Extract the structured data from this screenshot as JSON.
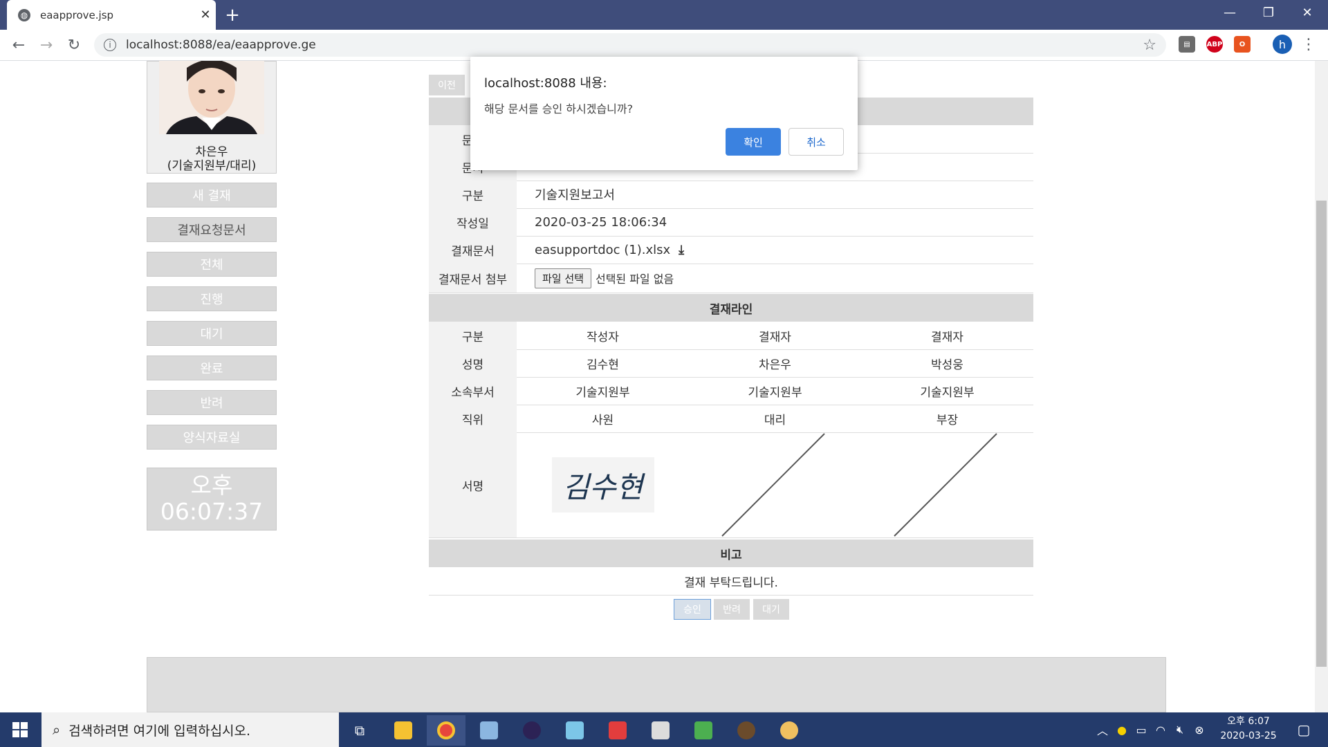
{
  "browser": {
    "tab_title": "eaapprove.jsp",
    "url": "localhost:8088/ea/eaapprove.ge"
  },
  "sidebar": {
    "user_name": "차은우",
    "user_dept": "(기술지원부/대리)",
    "menu": [
      "새 결재",
      "결재요청문서",
      "전체",
      "진행",
      "대기",
      "완료",
      "반려",
      "양식자료실"
    ],
    "clock_ampm": "오후",
    "clock_time": "06:07:37"
  },
  "document": {
    "prev_label": "이전",
    "row_doc_label_1": "문서",
    "row_doc_label_2": "문서",
    "type_label": "구분",
    "type_value": "기술지원보고서",
    "date_label": "작성일",
    "date_value": "2020-03-25 18:06:34",
    "file_label": "결재문서",
    "file_value": "easupportdoc (1).xlsx",
    "attach_label": "결재문서 첨부",
    "attach_button": "파일 선택",
    "attach_status": "선택된 파일 없음"
  },
  "approval": {
    "title": "결재라인",
    "row_labels": [
      "구분",
      "성명",
      "소속부서",
      "직위",
      "서명"
    ],
    "columns": [
      {
        "role": "작성자",
        "name": "김수현",
        "dept": "기술지원부",
        "position": "사원"
      },
      {
        "role": "결재자",
        "name": "차은우",
        "dept": "기술지원부",
        "position": "대리"
      },
      {
        "role": "결재자",
        "name": "박성웅",
        "dept": "기술지원부",
        "position": "부장"
      }
    ],
    "signature_text": "김수현"
  },
  "remarks": {
    "title": "비고",
    "text": "결재 부탁드립니다."
  },
  "actions": {
    "approve": "승인",
    "reject": "반려",
    "wait": "대기"
  },
  "dialog": {
    "title": "localhost:8088 내용:",
    "message": "해당 문서를 승인 하시겠습니까?",
    "ok": "확인",
    "cancel": "취소"
  },
  "taskbar": {
    "search_placeholder": "검색하려면 여기에 입력하십시오.",
    "time": "오후 6:07",
    "date": "2020-03-25"
  }
}
